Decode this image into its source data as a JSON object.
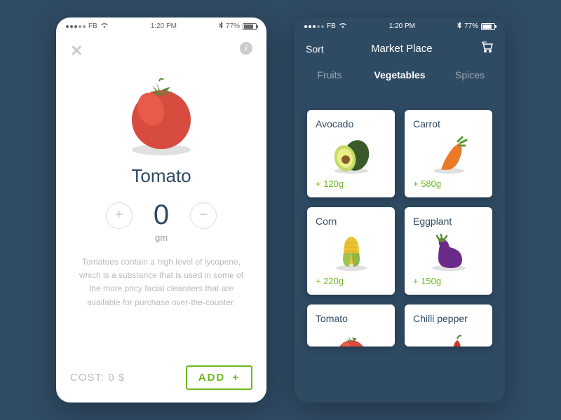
{
  "status": {
    "carrier": "FB",
    "time": "1:20 PM",
    "battery": "77%"
  },
  "detail": {
    "name": "Tomato",
    "qty": "0",
    "unit": "gm",
    "desc": "Tomatoes contain a high level of lycopene, which is a substance that is used in some of the more pricy facial cleansers that are available for purchase over-the-counter.",
    "cost_label": "COST:",
    "cost_value": "0 $",
    "add_label": "ADD"
  },
  "market": {
    "sort": "Sort",
    "title": "Market Place",
    "tabs": [
      "Fruits",
      "Vegetables",
      "Spices"
    ],
    "active_tab": 1,
    "items": [
      {
        "name": "Avocado",
        "weight": "+ 120g"
      },
      {
        "name": "Carrot",
        "weight": "+ 580g"
      },
      {
        "name": "Corn",
        "weight": "+ 220g"
      },
      {
        "name": "Eggplant",
        "weight": "+ 150g"
      },
      {
        "name": "Tomato",
        "weight": ""
      },
      {
        "name": "Chilli pepper",
        "weight": ""
      }
    ]
  }
}
